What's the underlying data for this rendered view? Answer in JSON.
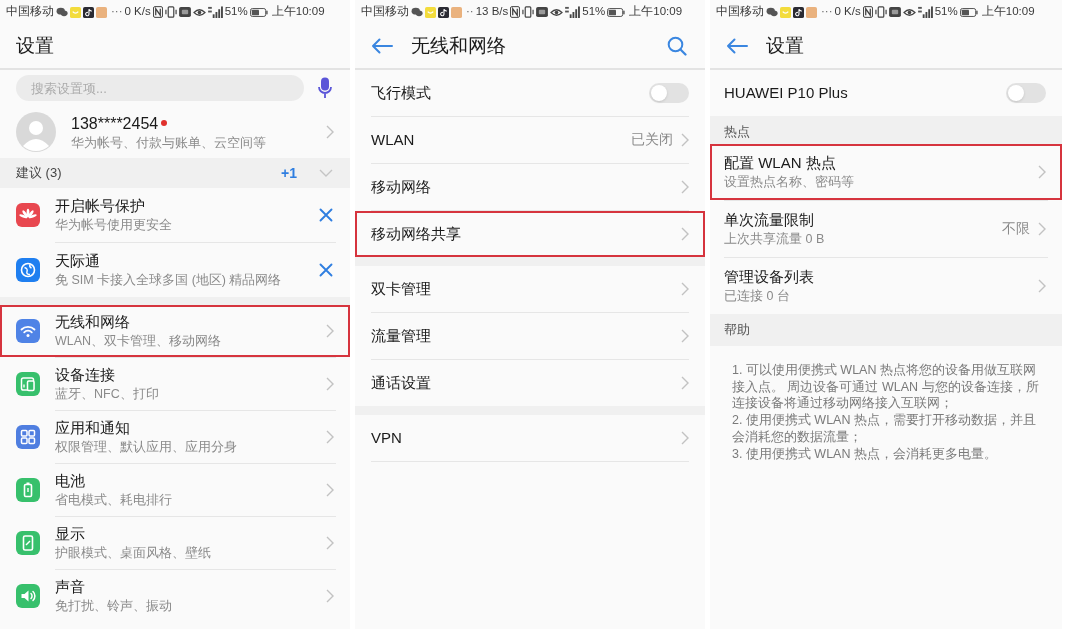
{
  "settings_screen": {
    "status_bar": {
      "carrier": "中国移动",
      "dots": "···",
      "speed": "0 K/s",
      "battery": "51%",
      "time": "上午10:09"
    },
    "title": "设置",
    "search": {
      "placeholder": "搜索设置项..."
    },
    "account": {
      "name": "138****2454",
      "unread": true,
      "subtitle": "华为帐号、付款与账单、云空间等"
    },
    "suggestions": {
      "label": "建议 (3)",
      "badge": "+1",
      "items": [
        {
          "title": "开启帐号保护",
          "subtitle": "华为帐号使用更安全"
        },
        {
          "title": "天际通",
          "subtitle": "免 SIM 卡接入全球多国 (地区) 精品网络"
        }
      ]
    },
    "menu": [
      {
        "title": "无线和网络",
        "subtitle": "WLAN、双卡管理、移动网络",
        "highlighted": true
      },
      {
        "title": "设备连接",
        "subtitle": "蓝牙、NFC、打印",
        "highlighted": false
      },
      {
        "title": "应用和通知",
        "subtitle": "权限管理、默认应用、应用分身",
        "highlighted": false
      },
      {
        "title": "电池",
        "subtitle": "省电模式、耗电排行",
        "highlighted": false
      },
      {
        "title": "显示",
        "subtitle": "护眼模式、桌面风格、壁纸",
        "highlighted": false
      },
      {
        "title": "声音",
        "subtitle": "免打扰、铃声、振动",
        "highlighted": false
      }
    ]
  },
  "network_screen": {
    "status_bar": {
      "carrier": "中国移动",
      "dots": "··",
      "speed": "13 B/s",
      "battery": "51%",
      "time": "上午10:09"
    },
    "title": "无线和网络",
    "sections": [
      {
        "items": [
          {
            "kind": "toggle",
            "title": "飞行模式",
            "on": false,
            "highlighted": false
          },
          {
            "kind": "link",
            "title": "WLAN",
            "value": "已关闭",
            "highlighted": false
          },
          {
            "kind": "link",
            "title": "移动网络",
            "highlighted": false
          },
          {
            "kind": "link",
            "title": "移动网络共享",
            "highlighted": true
          }
        ]
      },
      {
        "items": [
          {
            "kind": "link",
            "title": "双卡管理",
            "highlighted": false
          },
          {
            "kind": "link",
            "title": "流量管理",
            "highlighted": false
          },
          {
            "kind": "link",
            "title": "通话设置",
            "highlighted": false
          }
        ]
      },
      {
        "items": [
          {
            "kind": "link",
            "title": "VPN",
            "highlighted": false
          }
        ]
      }
    ]
  },
  "hotspot_screen": {
    "status_bar": {
      "carrier": "中国移动",
      "dots": "···",
      "speed": "0 K/s",
      "battery": "51%",
      "time": "上午10:09"
    },
    "title": "设置",
    "device": {
      "name": "HUAWEI P10 Plus",
      "on": false
    },
    "hotspot": {
      "heading": "热点",
      "items": [
        {
          "title": "配置 WLAN 热点",
          "subtitle": "设置热点名称、密码等",
          "highlighted": true
        },
        {
          "title": "单次流量限制",
          "subtitle": "上次共享流量 0 B",
          "value": "不限",
          "highlighted": false
        },
        {
          "title": "管理设备列表",
          "subtitle": "已连接 0 台",
          "highlighted": false
        }
      ]
    },
    "help": {
      "heading": "帮助",
      "paragraphs": [
        "1. 可以使用便携式 WLAN 热点将您的设备用做互联网接入点。 周边设备可通过 WLAN 与您的设备连接，所连接设备将通过移动网络接入互联网；",
        "2. 使用便携式 WLAN 热点，需要打开移动数据，并且会消耗您的数据流量；",
        "3. 使用便携式 WLAN 热点，会消耗更多电量。"
      ]
    }
  }
}
